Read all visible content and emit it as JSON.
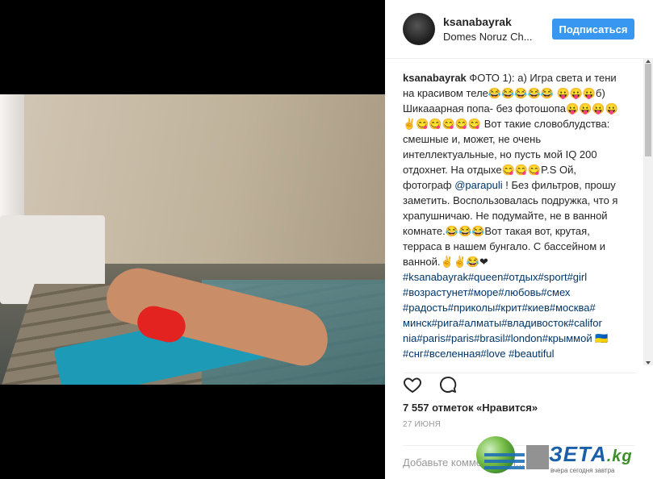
{
  "post": {
    "username": "ksanabayrak",
    "location": "Domes Noruz Ch...",
    "follow_label": "Подписаться",
    "caption": {
      "author": "ksanabayrak",
      "line1": " ФОТО 1): а) Игра света и тени на красивом теле😂😂😂😂😂",
      "line2": "😛😛😛б) Шикааарная попа- без фотошопа😛😛😛😛✌😋😋😋😋😋",
      "line3": "Вот такие словоблудства: смешные и, может, не очень интеллектуальные, но пусть мой IQ 200 отдохнет. На отдыхе😋😋😋P.S Ой, фотограф ",
      "mention": "@parapuli",
      "line4": " ! Без фильтров, прошу заметить. Воспользовалась подружка, что я храпушничаю. Не подумайте, не в ванной комнате.😂😂😂Вот такая вот, крутая, терраса в нашем бунгало. С бассейном и ванной.✌✌😂❤",
      "hashtags": "#ksanabayrak#queen#отдых#sport#girl #возрастунет#море#любовь#смех #радость#приколы#крит#киев#москва# минск#рига#алматы#владивосток#califor nia#paris#paris#brasil#london#крыммой 🇺🇦#снг#вселенная#love #beautiful"
    },
    "likes": "7 557 отметок «Нравится»",
    "date": "27 ИЮНЯ",
    "comment_placeholder": "Добавьте комментарий..."
  },
  "icons": {
    "like": "heart-icon",
    "comment": "comment-icon"
  },
  "watermark": {
    "brand_main": "ЗЕТА",
    "brand_suffix": ".kg",
    "tagline": "вчера сегодня завтра"
  },
  "colors": {
    "follow_button": "#3897f0",
    "hashtag": "#003569",
    "text": "#262626",
    "muted": "#999999"
  }
}
